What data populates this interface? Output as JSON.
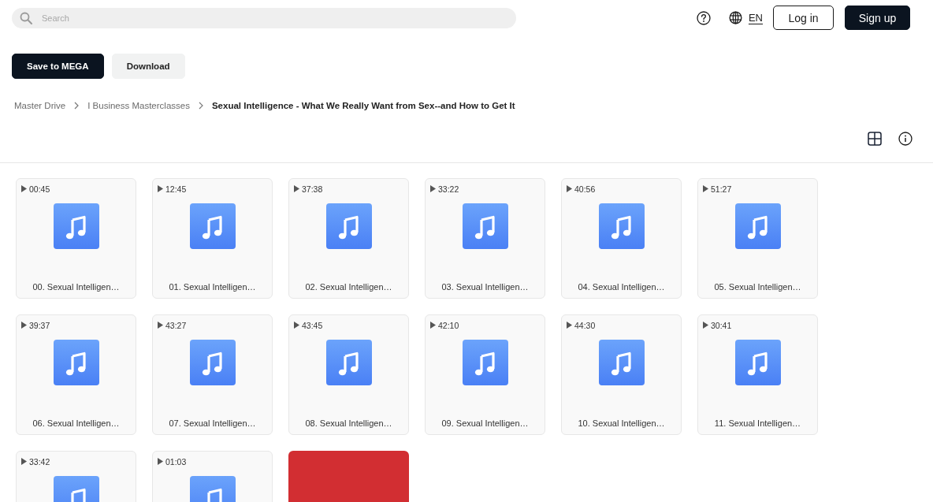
{
  "header": {
    "search": {
      "placeholder": "Search"
    },
    "language": "EN",
    "buttons": [
      {
        "label": "Log in",
        "kind": "outline"
      },
      {
        "label": "Sign up",
        "kind": "primary"
      }
    ]
  },
  "actions": [
    {
      "label": "Save to MEGA",
      "kind": "primary"
    },
    {
      "label": "Download",
      "kind": "secondary"
    }
  ],
  "breadcrumb": [
    {
      "label": "Master Drive",
      "current": false
    },
    {
      "label": "I Business Masterclasses",
      "current": false
    },
    {
      "label": "Sexual Intelligence - What We Really Want from Sex--and How to Get It",
      "current": true
    }
  ],
  "files": [
    {
      "kind": "audio",
      "duration": "00:45",
      "name": "00. Sexual Intelligen…"
    },
    {
      "kind": "audio",
      "duration": "12:45",
      "name": "01. Sexual Intelligen…"
    },
    {
      "kind": "audio",
      "duration": "37:38",
      "name": "02. Sexual Intelligen…"
    },
    {
      "kind": "audio",
      "duration": "33:22",
      "name": "03. Sexual Intelligen…"
    },
    {
      "kind": "audio",
      "duration": "40:56",
      "name": "04. Sexual Intelligen…"
    },
    {
      "kind": "audio",
      "duration": "51:27",
      "name": "05. Sexual Intelligen…"
    },
    {
      "kind": "audio",
      "duration": "39:37",
      "name": "06. Sexual Intelligen…"
    },
    {
      "kind": "audio",
      "duration": "43:27",
      "name": "07. Sexual Intelligen…"
    },
    {
      "kind": "audio",
      "duration": "43:45",
      "name": "08. Sexual Intelligen…"
    },
    {
      "kind": "audio",
      "duration": "42:10",
      "name": "09. Sexual Intelligen…"
    },
    {
      "kind": "audio",
      "duration": "44:30",
      "name": "10. Sexual Intelligen…"
    },
    {
      "kind": "audio",
      "duration": "30:41",
      "name": "11. Sexual Intelligen…"
    },
    {
      "kind": "audio",
      "duration": "33:42"
    },
    {
      "kind": "audio",
      "duration": "01:03"
    },
    {
      "kind": "image"
    }
  ]
}
